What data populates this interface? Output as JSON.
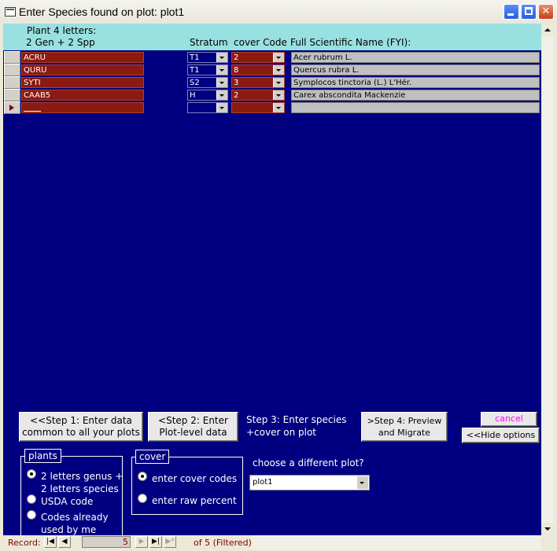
{
  "window": {
    "title": "Enter Species found on plot: plot1"
  },
  "header": {
    "plant_line1": "Plant 4 letters:",
    "plant_line2": "2 Gen + 2 Spp",
    "stratum": "Stratum",
    "cover_code": "cover Code",
    "full_name": "Full Scientific Name (FYI):"
  },
  "rows": [
    {
      "code": "ACRU",
      "stratum": "T1",
      "cover": "2",
      "full_name": "Acer rubrum L."
    },
    {
      "code": "QURU",
      "stratum": "T1",
      "cover": "8",
      "full_name": "Quercus rubra L."
    },
    {
      "code": "SYTI",
      "stratum": "S2",
      "cover": "3",
      "full_name": "Symplocos tinctoria (L.) L'Hér."
    },
    {
      "code": "CAAB5",
      "stratum": "H",
      "cover": "2",
      "full_name": "Carex abscondita Mackenzie"
    },
    {
      "code": "",
      "stratum": "",
      "cover": "",
      "full_name": ""
    }
  ],
  "steps": {
    "step1": "<<Step 1: Enter data common to all your plots",
    "step2": "<Step 2: Enter Plot-level data",
    "step3": "Step 3: Enter species +cover on plot",
    "step4": ">Step 4: Preview and Migrate",
    "cancel": "cancel",
    "hide": "<<Hide options"
  },
  "plants": {
    "legend": "plants",
    "opt1": "2 letters genus + 2 letters species",
    "opt1_a": "2 letters genus +",
    "opt1_b": "2 letters species",
    "opt2": "USDA code",
    "opt3_a": "Codes already",
    "opt3_b": "used by me",
    "selected": "2 letters genus + 2 letters species"
  },
  "cover": {
    "legend": "cover",
    "opt1": "enter cover codes",
    "opt2": "enter raw percent",
    "selected": "enter cover codes"
  },
  "plot_chooser": {
    "label": "choose a different plot?",
    "value": "plot1"
  },
  "navigation": {
    "label": "Record:",
    "current": "5",
    "of_text": "of  5 (Filtered)"
  },
  "colors": {
    "form_bg": "#000080",
    "header_bg": "#99e0e0",
    "entry_bg": "#8b1a10",
    "fullname_bg": "#c0c0c0",
    "cancel_text": "#ff00ff"
  }
}
